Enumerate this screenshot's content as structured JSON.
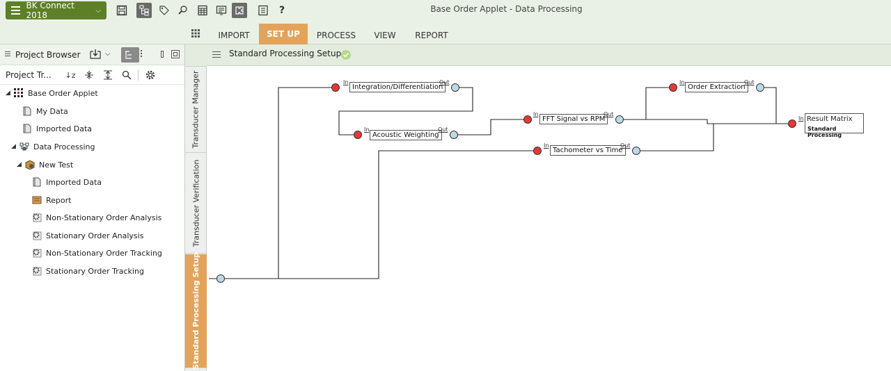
{
  "app": {
    "name": "BK Connect 2018",
    "window_title": "Base Order Applet - Data Processing"
  },
  "ribbon": {
    "tabs": [
      {
        "label": "IMPORT"
      },
      {
        "label": "SET UP"
      },
      {
        "label": "PROCESS"
      },
      {
        "label": "VIEW"
      },
      {
        "label": "REPORT"
      }
    ],
    "active_tab": "SET UP"
  },
  "project_browser": {
    "title": "Project Browser",
    "toolbar_label": "Project Tr...",
    "tree": [
      {
        "label": "Base Order Applet",
        "icon": "applet-grid-icon"
      },
      {
        "label": "My Data",
        "icon": "data-file-icon"
      },
      {
        "label": "Imported Data",
        "icon": "data-file-icon"
      },
      {
        "label": "Data Processing",
        "icon": "processing-icon"
      },
      {
        "label": "New Test",
        "icon": "test-box-icon"
      },
      {
        "label": "Imported Data",
        "icon": "data-file-icon"
      },
      {
        "label": "Report",
        "icon": "report-icon"
      },
      {
        "label": "Non-Stationary Order Analysis",
        "icon": "gear-doc-icon"
      },
      {
        "label": "Stationary Order Analysis",
        "icon": "gear-doc-icon"
      },
      {
        "label": "Non-Stationary Order Tracking",
        "icon": "gear-doc-icon"
      },
      {
        "label": "Stationary Order Tracking",
        "icon": "gear-doc-icon"
      }
    ]
  },
  "vertical_tabs": [
    {
      "label": "Transducer Manager"
    },
    {
      "label": "Transducer Verification"
    },
    {
      "label": "Standard Processing Setup"
    }
  ],
  "setup": {
    "title": "Standard Processing Setup"
  },
  "flow": {
    "in_label": "In",
    "out_label": "Out",
    "nodes": [
      {
        "label": "Integration/Differentiation"
      },
      {
        "label": "Acoustic Weighting"
      },
      {
        "label": "FFT Signal vs RPM"
      },
      {
        "label": "Tachometer vs Time"
      },
      {
        "label": "Order Extraction"
      },
      {
        "label": "Result Matrix",
        "sub": "Standard Processing"
      }
    ]
  },
  "colors": {
    "accent": "#e3a35b",
    "app_button": "#5d7f28",
    "in_port": "#e53935",
    "out_port": "#bcd9e8"
  }
}
